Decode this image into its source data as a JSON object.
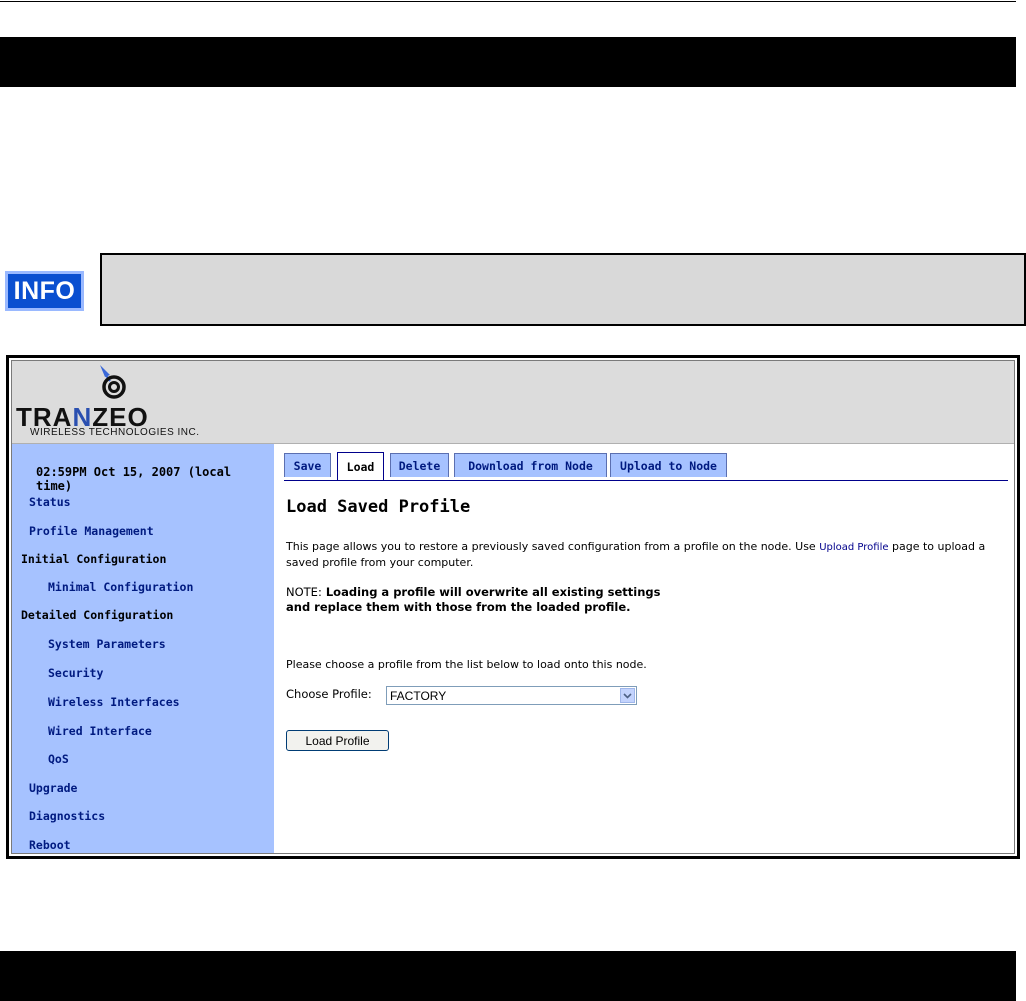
{
  "app": {
    "clock": "02:59PM Oct 15, 2007 (local time)"
  },
  "info_badge": {
    "label": "INFO"
  },
  "logo": {
    "brand_pre": "TRA",
    "brand_n": "N",
    "brand_post": "ZEO",
    "tagline": "WIRELESS TECHNOLOGIES INC."
  },
  "sidebar": {
    "items": [
      {
        "label": "Status"
      },
      {
        "label": "Profile Management"
      },
      {
        "label": "Initial Configuration"
      },
      {
        "label": "Minimal Configuration"
      },
      {
        "label": "Detailed Configuration"
      },
      {
        "label": "System Parameters"
      },
      {
        "label": "Security"
      },
      {
        "label": "Wireless Interfaces"
      },
      {
        "label": "Wired Interface"
      },
      {
        "label": "QoS"
      },
      {
        "label": "Upgrade"
      },
      {
        "label": "Diagnostics"
      },
      {
        "label": "Reboot"
      }
    ]
  },
  "tabs": [
    {
      "label": "Save"
    },
    {
      "label": "Load"
    },
    {
      "label": "Delete"
    },
    {
      "label": "Download from Node"
    },
    {
      "label": "Upload to Node"
    }
  ],
  "main": {
    "title": "Load Saved Profile",
    "intro_part1": "This page allows you to restore a previously saved configuration from a profile on the node. Use",
    "intro_link": "Upload Profile",
    "intro_part2": "page to upload a saved profile from your computer.",
    "note_prefix": "NOTE:",
    "note_text": "Loading a profile will overwrite all existing settings and replace them with those from the loaded profile.",
    "choose_text": "Please choose a profile from the list below to load onto this node.",
    "choose_label": "Choose Profile:",
    "profile_value": "FACTORY",
    "load_button": "Load Profile"
  },
  "colors": {
    "sidebar_bg": "#a6c2ff",
    "nav_text": "#001a80",
    "info_blue": "#0a4fd0"
  }
}
